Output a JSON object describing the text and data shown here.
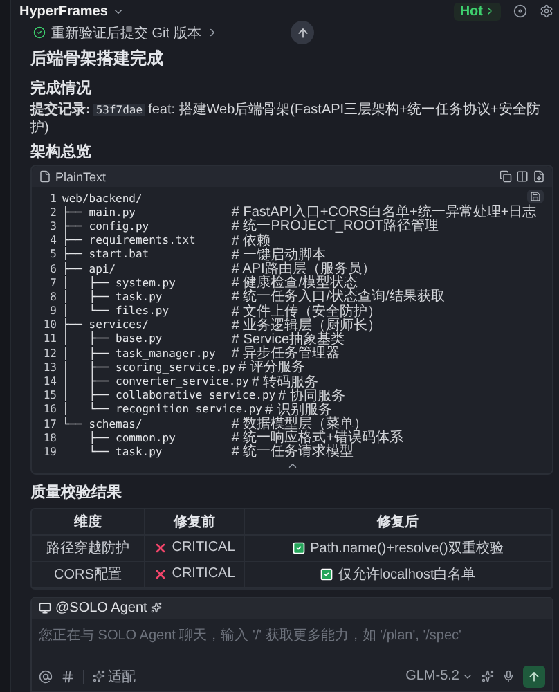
{
  "top_bar": {
    "title": "HyperFrames",
    "badge": "Hot"
  },
  "status": {
    "text": "重新验证后提交 Git 版本"
  },
  "heading": "后端骨架搭建完成",
  "completion": {
    "heading": "完成情况",
    "label": "提交记录:",
    "hash": "53f7dae",
    "message": "feat: 搭建Web后端骨架(FastAPI三层架构+统一任务协议+安全防护)"
  },
  "architecture": {
    "heading": "架构总览",
    "language": "PlainText",
    "lines": [
      {
        "number": "1",
        "code": "web/backend/"
      },
      {
        "number": "2",
        "code": "├── main.py",
        "comment": "# FastAPI入口+CORS白名单+统一异常处理+日志"
      },
      {
        "number": "3",
        "code": "├── config.py",
        "comment": "# 统一PROJECT_ROOT路径管理"
      },
      {
        "number": "4",
        "code": "├── requirements.txt",
        "comment": "# 依赖"
      },
      {
        "number": "5",
        "code": "├── start.bat",
        "comment": "# 一键启动脚本"
      },
      {
        "number": "6",
        "code": "├── api/",
        "comment": "# API路由层（服务员）"
      },
      {
        "number": "7",
        "code": "│   ├── system.py",
        "comment": "# 健康检查/模型状态"
      },
      {
        "number": "8",
        "code": "│   ├── task.py",
        "comment": "# 统一任务入口/状态查询/结果获取"
      },
      {
        "number": "9",
        "code": "│   └── files.py",
        "comment": "# 文件上传（安全防护）"
      },
      {
        "number": "10",
        "code": "├── services/",
        "comment": "# 业务逻辑层（厨师长）"
      },
      {
        "number": "11",
        "code": "│   ├── base.py",
        "comment": "# Service抽象基类"
      },
      {
        "number": "12",
        "code": "│   ├── task_manager.py",
        "comment": "# 异步任务管理器"
      },
      {
        "number": "13",
        "code": "│   ├── scoring_service.py",
        "comment": "# 评分服务"
      },
      {
        "number": "14",
        "code": "│   ├── converter_service.py",
        "comment": "# 转码服务"
      },
      {
        "number": "15",
        "code": "│   ├── collaborative_service.py",
        "comment": "# 协同服务"
      },
      {
        "number": "16",
        "code": "│   └── recognition_service.py",
        "comment": "# 识别服务"
      },
      {
        "number": "17",
        "code": "└── schemas/",
        "comment": "# 数据模型层（菜单）"
      },
      {
        "number": "18",
        "code": "    ├── common.py",
        "comment": "# 统一响应格式+错误码体系"
      },
      {
        "number": "19",
        "code": "    └── task.py",
        "comment": "# 统一任务请求模型"
      }
    ]
  },
  "quality": {
    "heading": "质量校验结果",
    "columns": [
      "维度",
      "修复前",
      "修复后"
    ],
    "rows": [
      {
        "cells": [
          {
            "kind": "plain",
            "text": "路径穿越防护"
          },
          {
            "kind": "fail",
            "text": "CRITICAL"
          },
          {
            "kind": "pass",
            "text": "Path.name()+resolve()双重校验"
          }
        ]
      },
      {
        "cells": [
          {
            "kind": "plain",
            "text": "CORS配置"
          },
          {
            "kind": "fail",
            "text": "CRITICAL"
          },
          {
            "kind": "pass",
            "text": "仅允许localhost白名单"
          }
        ]
      }
    ]
  },
  "composer": {
    "agent": "@SOLO Agent",
    "placeholder": "您正在与 SOLO Agent 聊天，输入 '/' 获取更多能力，如 '/plan', '/spec'",
    "tool": "适配",
    "model": "GLM-5.2"
  }
}
